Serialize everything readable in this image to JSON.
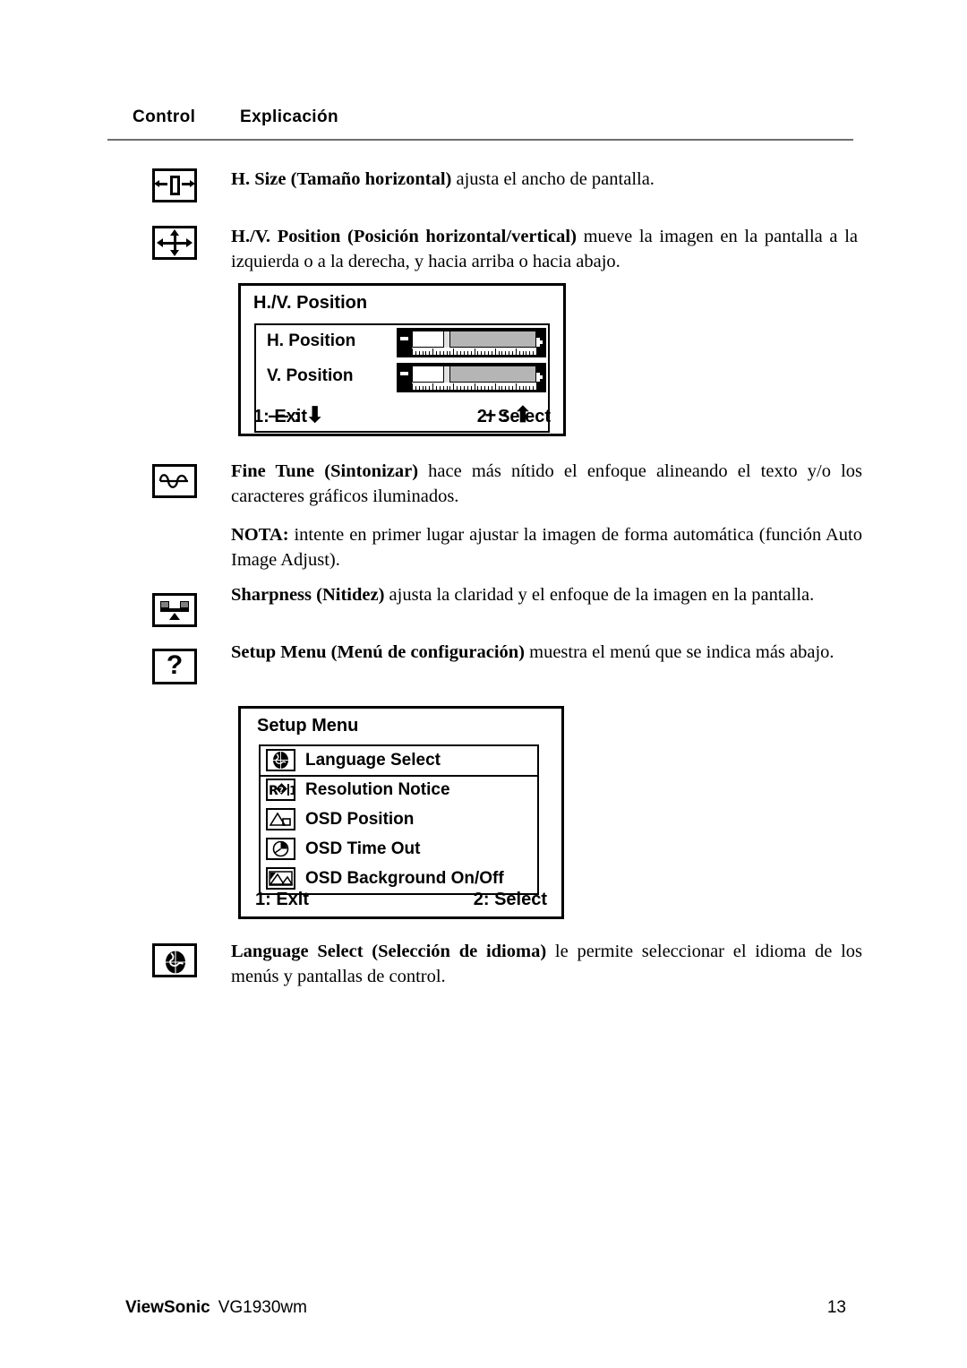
{
  "header": {
    "col_control": "Control",
    "col_explanation": "Explicación"
  },
  "entries": [
    {
      "icon": "h-size-icon",
      "paragraphs": [
        {
          "bold": "H. Size (Tamaño horizontal)",
          "rest": " ajusta el ancho de pantalla."
        }
      ]
    },
    {
      "icon": "hv-position-icon",
      "paragraphs": [
        {
          "bold": "H./V. Position (Posición horizontal/vertical)",
          "rest": " mueve la imagen en la pantalla a la izquierda o a la derecha, y hacia arriba o hacia abajo."
        }
      ]
    },
    {
      "icon": "fine-tune-icon",
      "paragraphs": [
        {
          "bold": "Fine Tune (Sintonizar)",
          "rest": " hace más nítido el enfoque alineando el texto y/o los caracteres gráficos iluminados."
        },
        {
          "bold": "NOTA:",
          "rest": " intente en primer lugar ajustar la imagen de forma automática (función Auto Image Adjust)."
        }
      ]
    },
    {
      "icon": "sharpness-icon",
      "paragraphs": [
        {
          "bold": "Sharpness (Nitidez)",
          "rest": " ajusta la claridad y el enfoque de la imagen en la pantalla."
        }
      ]
    },
    {
      "icon": "setup-menu-icon",
      "paragraphs": [
        {
          "bold": "Setup Menu (Menú de configuración)",
          "rest": " muestra el menú que se indica más abajo."
        }
      ]
    },
    {
      "icon": "language-select-icon",
      "paragraphs": [
        {
          "bold": "Language Select (Selección de idioma)",
          "rest": " le permite seleccionar el idioma de los menús y pantallas de control."
        }
      ]
    }
  ],
  "osd_hv_position": {
    "title": "H./V. Position",
    "rows": [
      {
        "label": "H. Position",
        "value_percent": 28
      },
      {
        "label": "V. Position",
        "value_percent": 28
      }
    ],
    "minus_hint": "— :",
    "plus_hint": "+ :",
    "minus_arrow": "down-arrow-icon",
    "plus_arrow": "up-arrow-icon",
    "footer_left": "1: Exit",
    "footer_right": "2: Select"
  },
  "osd_setup_menu": {
    "title": "Setup Menu",
    "items": [
      {
        "label": "Language Select",
        "icon": "globe-icon"
      },
      {
        "label": "Resolution Notice",
        "icon": "resolution-icon"
      },
      {
        "label": "OSD Position",
        "icon": "osd-position-icon"
      },
      {
        "label": "OSD Time Out",
        "icon": "clock-icon"
      },
      {
        "label": "OSD Background On/Off",
        "icon": "background-icon"
      }
    ],
    "footer_left": "1: Exit",
    "footer_right": "2: Select"
  },
  "footer": {
    "brand": "ViewSonic",
    "model": "VG1930wm",
    "page_number": "13"
  },
  "colors": {
    "text": "#000000",
    "rule": "#6f6f6f",
    "slider_track": "#b5b5b5",
    "slider_fill": "#ffffff",
    "osd_bar_bg": "#000000"
  }
}
